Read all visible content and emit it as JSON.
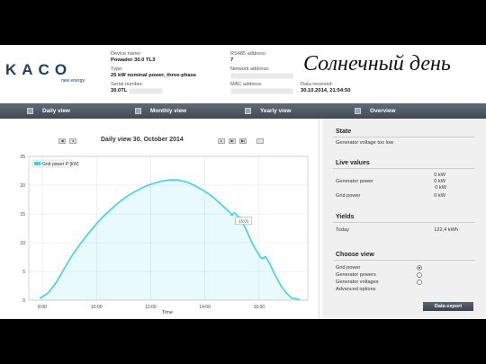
{
  "overlay_title": "Солнечный день",
  "header": {
    "logo_text": "KACO",
    "logo_sub": "new energy.",
    "device_name_label": "Device name:",
    "device_name_value": "Powador 30.0 TL3",
    "type_label": "Type:",
    "type_value": "25 kW nominal power, three-phase",
    "serial_label": "Serial number:",
    "serial_value": "30.0TL",
    "rs485_label": "RS485 address:",
    "rs485_value": "7",
    "network_label": "Network address:",
    "mac_label": "MAC address:",
    "received_label": "Data received:",
    "received_value": "30.10.2014, 21:54:50"
  },
  "nav": {
    "daily": "Daily view",
    "monthly": "Monthly view",
    "yearly": "Yearly view",
    "overview": "Overview"
  },
  "controls": {
    "prev_label": "◀",
    "back_label": "◂",
    "fwd_label": "▸",
    "next_label": "▶",
    "end_label": "▶|"
  },
  "daily": {
    "title": "Daily view 30. October 2014"
  },
  "chart_data": {
    "type": "area",
    "title": "",
    "xlabel": "Time",
    "ylabel": "",
    "legend": "Grid power P [kW]",
    "x_ticks": [
      "8:00",
      "10:00",
      "12:00",
      "14:00",
      "16:00"
    ],
    "y_ticks": [
      "0",
      "5",
      "10",
      "15",
      "20",
      "25"
    ],
    "ylim": [
      0,
      25
    ],
    "xlim": [
      7.5,
      17.8
    ],
    "color": "#3fd2e4",
    "tooltip": "15:01",
    "series": [
      {
        "x": [
          7.9,
          8.2,
          8.5,
          8.8,
          9.1,
          9.4,
          9.7,
          10.0,
          10.3,
          10.6,
          10.9,
          11.2,
          11.5,
          11.8,
          12.1,
          12.4,
          12.7,
          13.0,
          13.3,
          13.6,
          13.9,
          14.2,
          14.5,
          14.8,
          15.0,
          15.1,
          15.3,
          15.5,
          15.7,
          15.9,
          16.1,
          16.25,
          16.4,
          16.6,
          16.8,
          17.0,
          17.2,
          17.5
        ],
        "y": [
          0.3,
          1.2,
          3.0,
          5.4,
          7.8,
          9.8,
          11.6,
          13.3,
          14.8,
          16.1,
          17.3,
          18.3,
          19.1,
          19.8,
          20.3,
          20.7,
          20.9,
          20.9,
          20.6,
          20.0,
          19.2,
          18.3,
          17.1,
          15.8,
          14.9,
          15.2,
          14.2,
          12.5,
          10.4,
          8.6,
          7.2,
          7.6,
          6.3,
          4.3,
          2.6,
          1.3,
          0.4,
          0.1
        ]
      }
    ]
  },
  "state": {
    "title": "State",
    "text": "Generator voltage too low"
  },
  "live": {
    "title": "Live values",
    "gen_power_label": "Generator power",
    "grid_power_label": "Grid power",
    "v1": "0 kW",
    "v2": "0 kW",
    "v3": "0 kW",
    "v4": "0 kW"
  },
  "yields": {
    "title": "Yields",
    "today_label": "Today",
    "today_value": "122,4 kWh"
  },
  "choose": {
    "title": "Choose view",
    "opt1": "Grid power",
    "opt2": "Generator powers",
    "opt3": "Generator voltages",
    "opt4": "Advanced options"
  },
  "export_label": "Data export"
}
